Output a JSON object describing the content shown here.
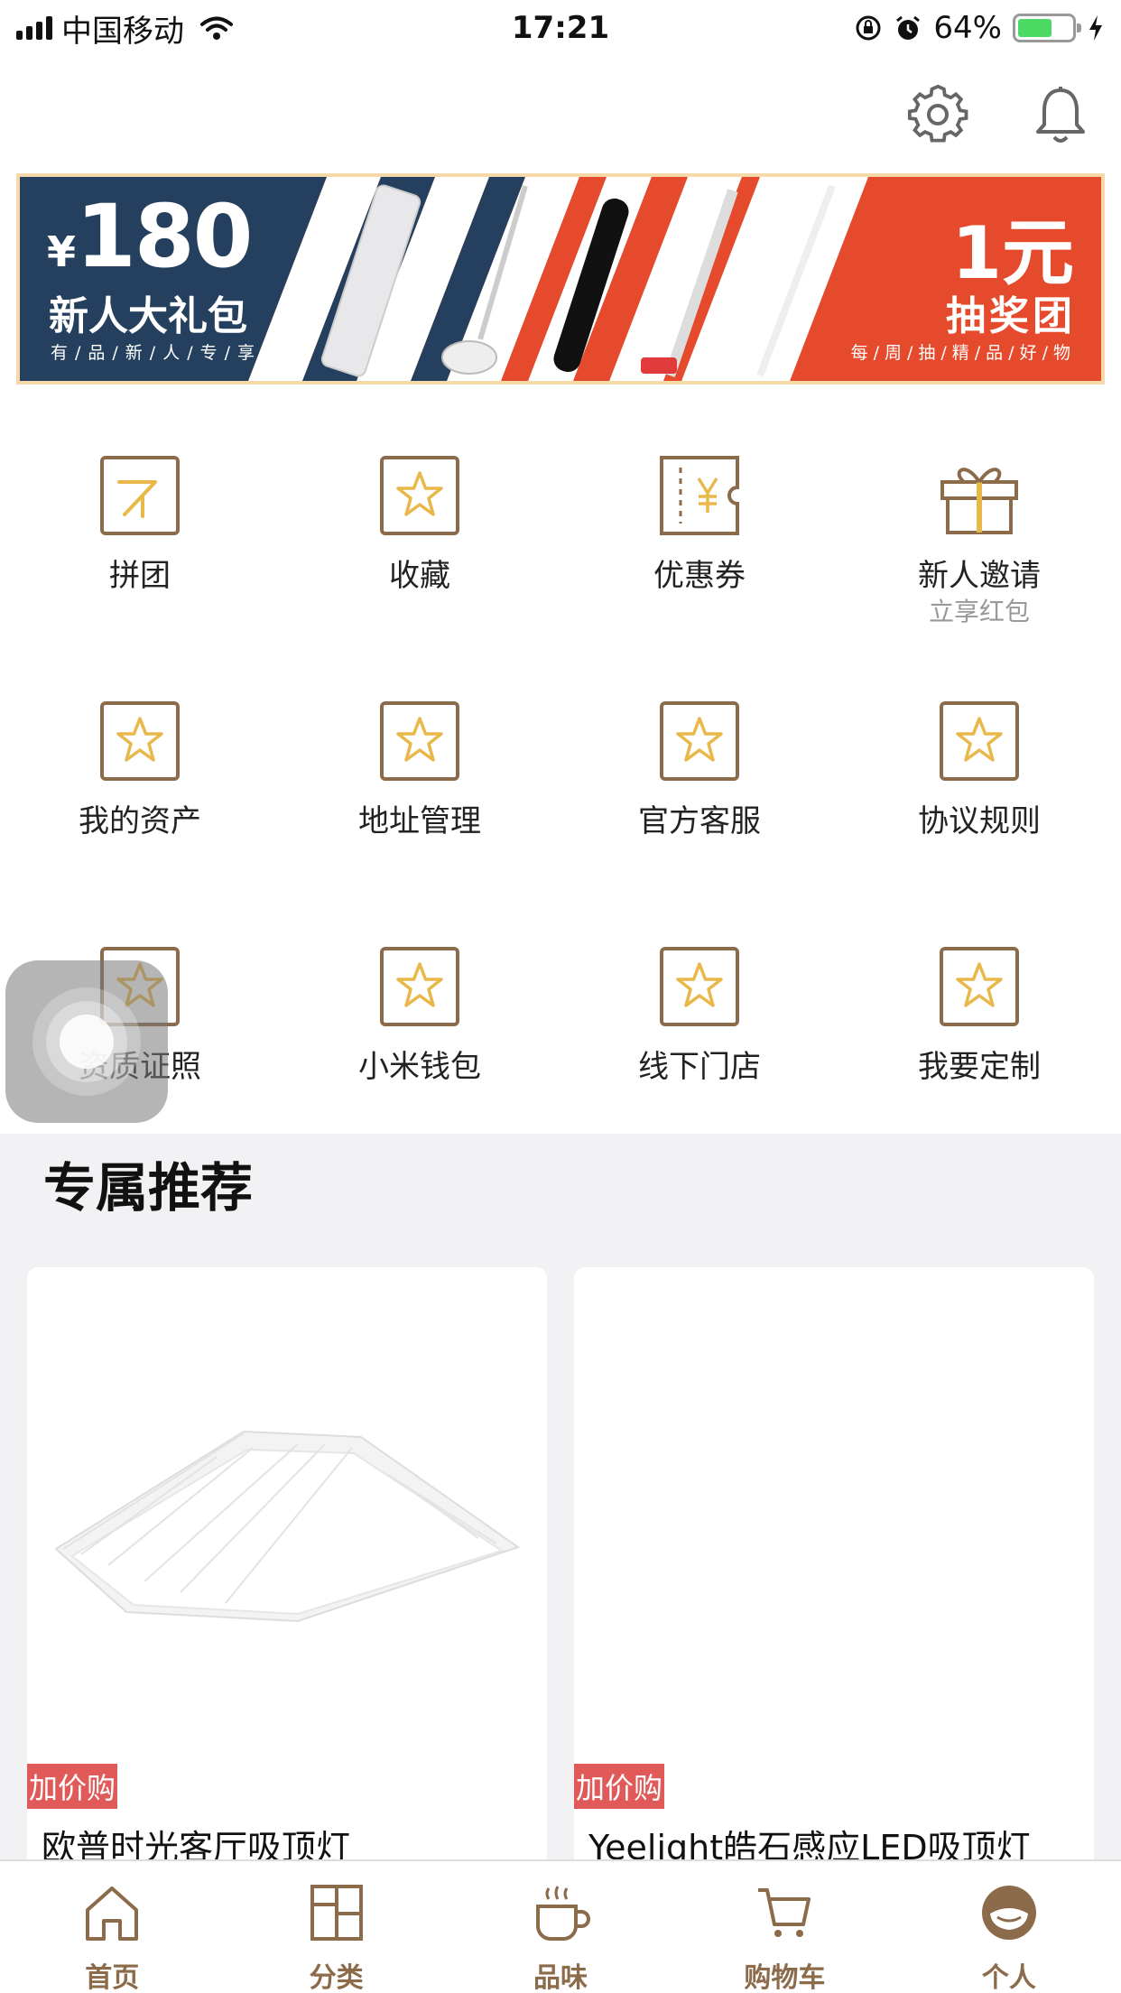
{
  "status_bar": {
    "carrier": "中国移动",
    "time": "17:21",
    "battery": "64%",
    "battery_level": 0.64
  },
  "top_bar": {
    "settings_icon": "gear-icon",
    "notification_icon": "bell-icon"
  },
  "banner": {
    "left_currency": "¥",
    "left_amount": "180",
    "left_title": "新人大礼包",
    "left_subtitle": "有/品/新/人/专/享",
    "right_amount": "1元",
    "right_title": "抽奖团",
    "right_subtitle": "每/周/抽/精/品/好/物"
  },
  "menu": [
    {
      "label": "拼团",
      "sub": "",
      "icon": "group-buy-icon"
    },
    {
      "label": "收藏",
      "sub": "",
      "icon": "star-icon"
    },
    {
      "label": "优惠券",
      "sub": "",
      "icon": "coupon-icon"
    },
    {
      "label": "新人邀请",
      "sub": "立享红包",
      "icon": "gift-icon"
    },
    {
      "label": "我的资产",
      "sub": "",
      "icon": "star-icon"
    },
    {
      "label": "地址管理",
      "sub": "",
      "icon": "star-icon"
    },
    {
      "label": "官方客服",
      "sub": "",
      "icon": "star-icon"
    },
    {
      "label": "协议规则",
      "sub": "",
      "icon": "star-icon"
    },
    {
      "label": "资质证照",
      "sub": "",
      "icon": "star-icon"
    },
    {
      "label": "小米钱包",
      "sub": "",
      "icon": "star-icon"
    },
    {
      "label": "线下门店",
      "sub": "",
      "icon": "star-icon"
    },
    {
      "label": "我要定制",
      "sub": "",
      "icon": "star-icon"
    }
  ],
  "recommend": {
    "title": "专属推荐",
    "products": [
      {
        "tag": "加价购",
        "name": "欧普时光客厅吸顶灯"
      },
      {
        "tag": "加价购",
        "name": "Yeelight皓石感应LED吸顶灯"
      }
    ]
  },
  "tabbar": [
    {
      "label": "首页",
      "icon": "home-icon"
    },
    {
      "label": "分类",
      "icon": "category-icon"
    },
    {
      "label": "品味",
      "icon": "cup-icon"
    },
    {
      "label": "购物车",
      "icon": "cart-icon"
    },
    {
      "label": "个人",
      "icon": "profile-icon"
    }
  ],
  "colors": {
    "accent": "#8b6b4a",
    "icon_gold": "#e8b84a",
    "banner_navy": "#24405e",
    "banner_red": "#e44a2b",
    "tag_red": "#e05a5a"
  }
}
